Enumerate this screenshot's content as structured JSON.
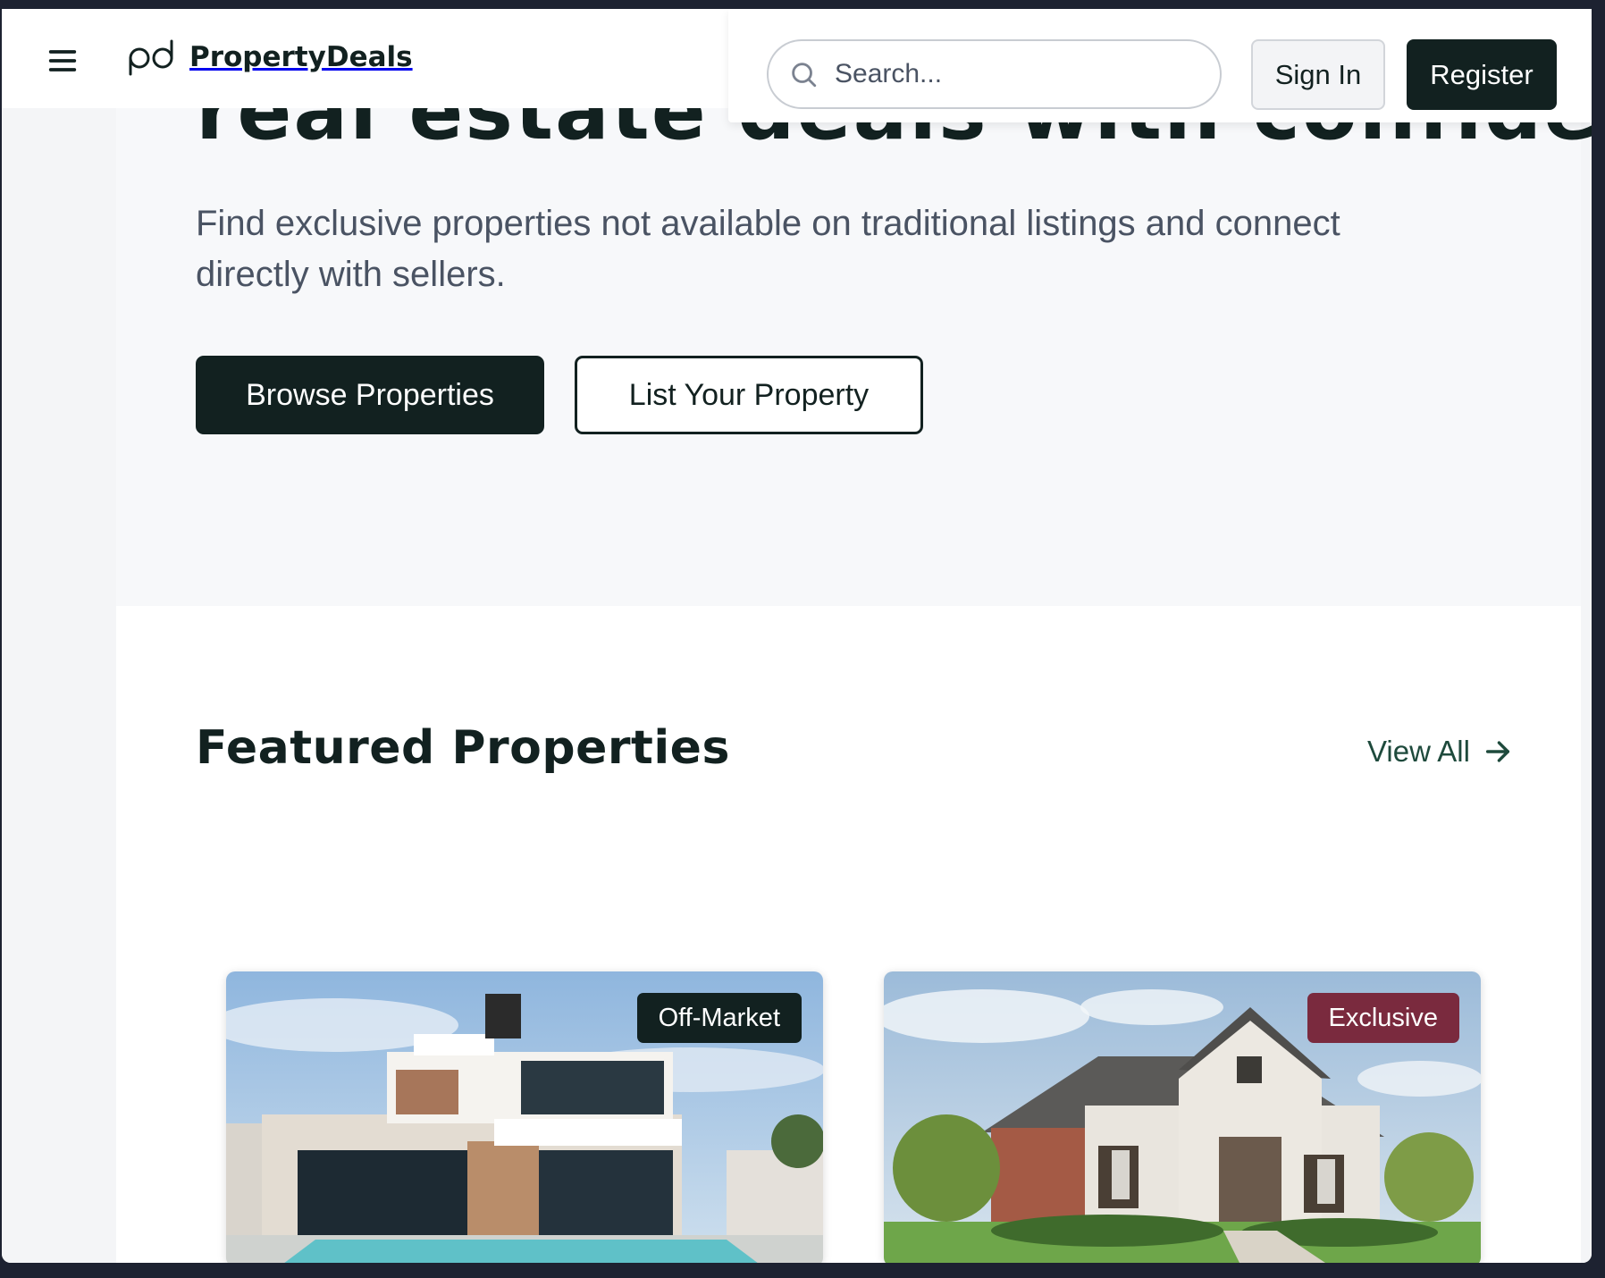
{
  "header": {
    "brand": "PropertyDeals",
    "search_placeholder": "Search...",
    "sign_in_label": "Sign In",
    "register_label": "Register"
  },
  "hero": {
    "title": "real estate deals with confidence.",
    "subtitle": "Find exclusive properties not available on traditional listings and connect directly with sellers.",
    "browse_label": "Browse Properties",
    "list_label": "List Your Property"
  },
  "featured": {
    "title": "Featured Properties",
    "view_all_label": "View All",
    "cards": [
      {
        "badge": "Off-Market",
        "badge_color": "#122120"
      },
      {
        "badge": "Exclusive",
        "badge_color": "#7a2a3e"
      }
    ]
  },
  "colors": {
    "primary": "#122120",
    "accent_link": "#1e4a3c",
    "exclusive": "#7a2a3e"
  },
  "icons": [
    "menu-icon",
    "logo-mark-icon",
    "search-icon",
    "arrow-right-icon"
  ]
}
